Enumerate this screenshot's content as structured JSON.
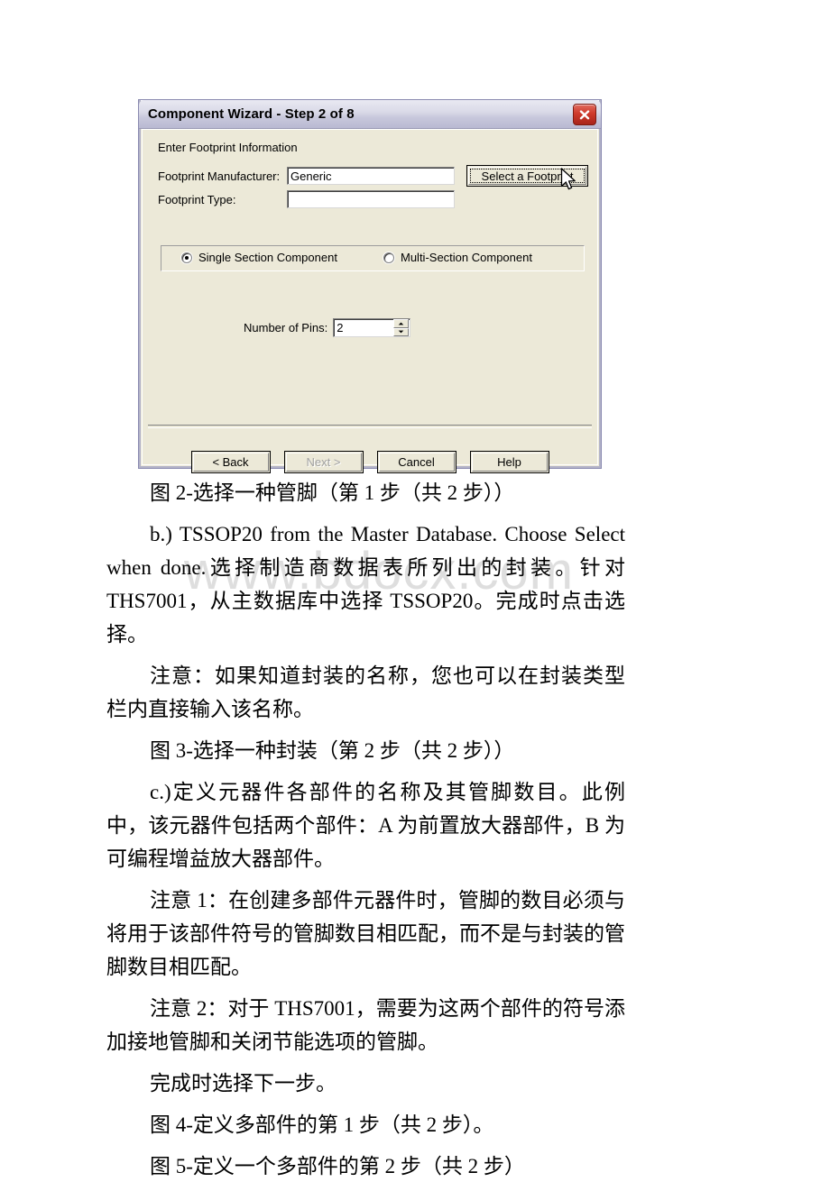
{
  "watermark": "www.bdocx.com",
  "dialog": {
    "title": "Component Wizard - Step 2 of 8",
    "close_icon": "close-icon",
    "section_label": "Enter Footprint Information",
    "fields": [
      {
        "label": "Footprint Manufacturer:",
        "value": "Generic",
        "placeholder": ""
      },
      {
        "label": "Footprint Type:",
        "value": "",
        "placeholder": ""
      }
    ],
    "select_footprint_button": "Select a Footprint",
    "radios": [
      {
        "label": "Single Section Component",
        "selected": true
      },
      {
        "label": "Multi-Section Component",
        "selected": false
      }
    ],
    "pins": {
      "label": "Number of Pins:",
      "value": "2",
      "spin_up_icon": "caret-up-icon",
      "spin_down_icon": "caret-down-icon"
    },
    "buttons": [
      {
        "label": "< Back",
        "enabled": true
      },
      {
        "label": "Next >",
        "enabled": false
      },
      {
        "label": "Cancel",
        "enabled": true
      },
      {
        "label": "Help",
        "enabled": true
      }
    ],
    "cursor_icon": "mouse-pointer-icon"
  },
  "document": {
    "paragraphs": [
      "图 2-选择一种管脚（第 1 步（共 2 步））",
      "b.) TSSOP20 from the Master Database. Choose Select when done.选择制造商数据表所列出的封装。针对 THS7001，从主数据库中选择 TSSOP20。完成时点击选择。",
      "注意：如果知道封装的名称，您也可以在封装类型栏内直接输入该名称。",
      "图 3-选择一种封装（第 2 步（共 2 步））",
      "c.)定义元器件各部件的名称及其管脚数目。此例中，该元器件包括两个部件：A 为前置放大器部件，B 为可编程增益放大器部件。",
      "注意 1：在创建多部件元器件时，管脚的数目必须与将用于该部件符号的管脚数目相匹配，而不是与封装的管脚数目相匹配。",
      "注意 2：对于 THS7001，需要为这两个部件的符号添加接地管脚和关闭节能选项的管脚。",
      "完成时选择下一步。",
      "图 4-定义多部件的第 1 步（共 2 步）。",
      "图 5-定义一个多部件的第 2 步（共 2 步）"
    ]
  }
}
